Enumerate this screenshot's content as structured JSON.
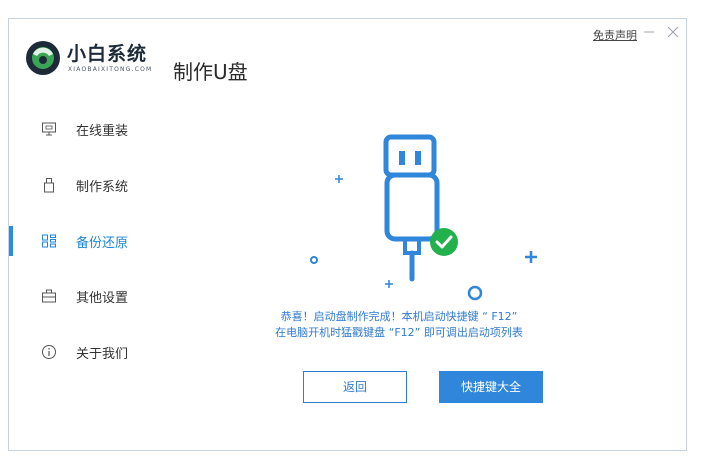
{
  "header": {
    "brand_name": "小白系统",
    "brand_domain": "XIAOBAIXITONG.COM",
    "page_title": "制作U盘",
    "disclaimer_link": "免责声明"
  },
  "sidebar": {
    "items": [
      {
        "label": "在线重装",
        "icon": "monitor-icon"
      },
      {
        "label": "制作系统",
        "icon": "usb-drive-icon"
      },
      {
        "label": "备份还原",
        "icon": "grid-icon",
        "active": true
      },
      {
        "label": "其他设置",
        "icon": "briefcase-icon"
      },
      {
        "label": "关于我们",
        "icon": "info-icon"
      }
    ]
  },
  "main": {
    "message_line1": "恭喜！启动盘制作完成！本机启动快捷键 “ F12”",
    "message_line2": "在电脑开机时猛戳键盘 “F12” 即可调出启动项列表",
    "back_button": "返回",
    "hotkeys_button": "快捷键大全"
  },
  "colors": {
    "accent": "#2f86da",
    "success": "#22b14c",
    "active_bar": "#2a8ce0"
  }
}
